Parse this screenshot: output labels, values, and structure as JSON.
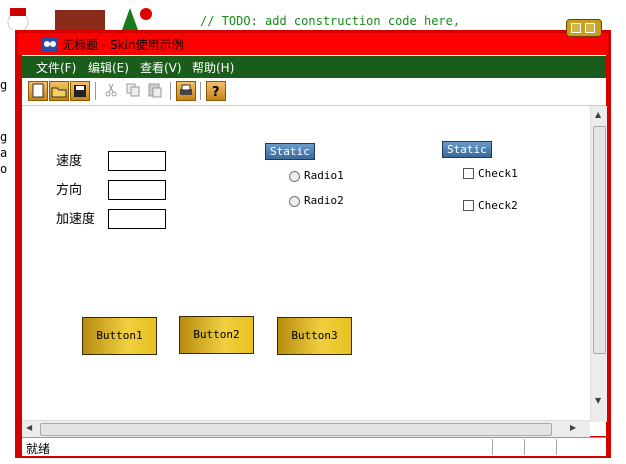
{
  "background_code": "// TODO: add construction code here,",
  "window": {
    "title": "无标题 - Skin使用示例"
  },
  "menu": {
    "items": [
      "文件(F)",
      "编辑(E)",
      "查看(V)",
      "帮助(H)"
    ]
  },
  "toolbar": {
    "icons": [
      "new-icon",
      "open-icon",
      "save-icon",
      "cut-icon",
      "copy-icon",
      "paste-icon",
      "print-icon",
      "help-icon"
    ]
  },
  "form": {
    "labels": [
      "速度",
      "方向",
      "加速度"
    ],
    "static1": "Static",
    "static2": "Static",
    "radio1": "Radio1",
    "radio2": "Radio2",
    "check1": "Check1",
    "check2": "Check2",
    "button1": "Button1",
    "button2": "Button2",
    "button3": "Button3"
  },
  "status": {
    "text": "就绪"
  },
  "colors": {
    "frame": "#d40000",
    "menubar": "#1a5c1a",
    "button_gold": "#e8c020",
    "static_blue": "#3a6a9a"
  }
}
